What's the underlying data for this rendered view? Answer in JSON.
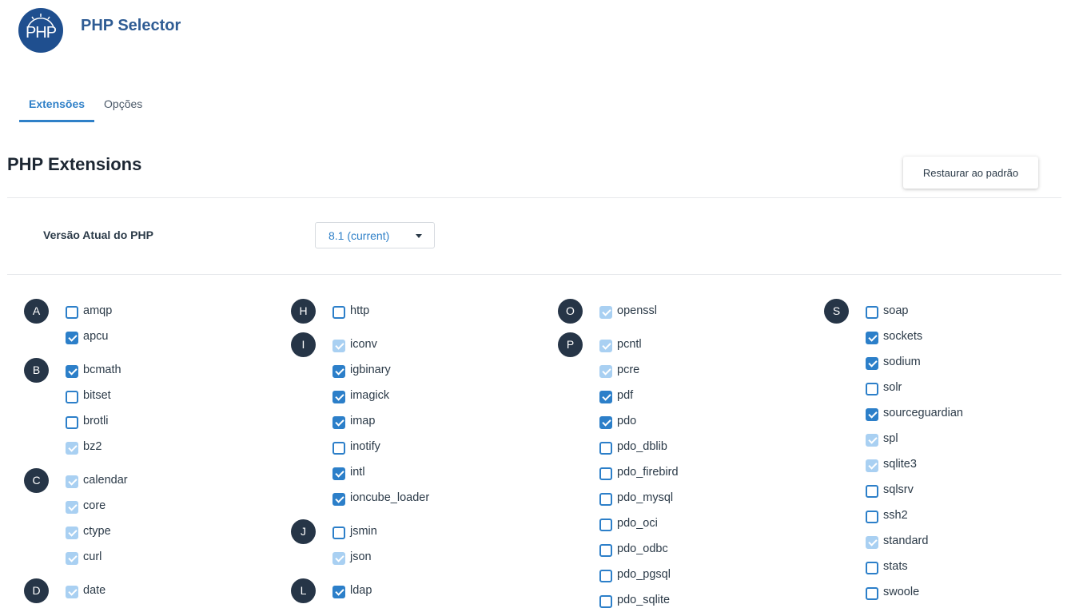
{
  "header": {
    "logo_text": "PHP",
    "title": "PHP Selector"
  },
  "tabs": [
    {
      "label": "Extensões",
      "active": true
    },
    {
      "label": "Opções",
      "active": false
    }
  ],
  "section": {
    "title": "PHP Extensions",
    "restore_label": "Restaurar ao padrão"
  },
  "version": {
    "label": "Versão Atual do PHP",
    "value": "8.1 (current)"
  },
  "colors": {
    "accent": "#2c7fc9",
    "disabled_check": "#a9d0f2",
    "letter_badge": "#263547",
    "title": "#2f5c94"
  },
  "columns": [
    [
      {
        "letter": "A",
        "items": [
          {
            "label": "amqp",
            "state": "unchecked"
          },
          {
            "label": "apcu",
            "state": "checked"
          }
        ]
      },
      {
        "letter": "B",
        "items": [
          {
            "label": "bcmath",
            "state": "checked"
          },
          {
            "label": "bitset",
            "state": "unchecked"
          },
          {
            "label": "brotli",
            "state": "unchecked"
          },
          {
            "label": "bz2",
            "state": "disabled"
          }
        ]
      },
      {
        "letter": "C",
        "items": [
          {
            "label": "calendar",
            "state": "disabled"
          },
          {
            "label": "core",
            "state": "disabled"
          },
          {
            "label": "ctype",
            "state": "disabled"
          },
          {
            "label": "curl",
            "state": "disabled"
          }
        ]
      },
      {
        "letter": "D",
        "items": [
          {
            "label": "date",
            "state": "disabled"
          }
        ]
      }
    ],
    [
      {
        "letter": "H",
        "items": [
          {
            "label": "http",
            "state": "unchecked"
          }
        ]
      },
      {
        "letter": "I",
        "items": [
          {
            "label": "iconv",
            "state": "disabled"
          },
          {
            "label": "igbinary",
            "state": "checked"
          },
          {
            "label": "imagick",
            "state": "checked"
          },
          {
            "label": "imap",
            "state": "checked"
          },
          {
            "label": "inotify",
            "state": "unchecked"
          },
          {
            "label": "intl",
            "state": "checked"
          },
          {
            "label": "ioncube_loader",
            "state": "checked"
          }
        ]
      },
      {
        "letter": "J",
        "items": [
          {
            "label": "jsmin",
            "state": "unchecked"
          },
          {
            "label": "json",
            "state": "disabled"
          }
        ]
      },
      {
        "letter": "L",
        "items": [
          {
            "label": "ldap",
            "state": "checked"
          }
        ]
      }
    ],
    [
      {
        "letter": "O",
        "items": [
          {
            "label": "openssl",
            "state": "disabled"
          }
        ]
      },
      {
        "letter": "P",
        "items": [
          {
            "label": "pcntl",
            "state": "disabled"
          },
          {
            "label": "pcre",
            "state": "disabled"
          },
          {
            "label": "pdf",
            "state": "checked"
          },
          {
            "label": "pdo",
            "state": "checked"
          },
          {
            "label": "pdo_dblib",
            "state": "unchecked"
          },
          {
            "label": "pdo_firebird",
            "state": "unchecked"
          },
          {
            "label": "pdo_mysql",
            "state": "unchecked"
          },
          {
            "label": "pdo_oci",
            "state": "unchecked"
          },
          {
            "label": "pdo_odbc",
            "state": "unchecked"
          },
          {
            "label": "pdo_pgsql",
            "state": "unchecked"
          },
          {
            "label": "pdo_sqlite",
            "state": "unchecked"
          }
        ]
      }
    ],
    [
      {
        "letter": "S",
        "items": [
          {
            "label": "soap",
            "state": "unchecked"
          },
          {
            "label": "sockets",
            "state": "checked"
          },
          {
            "label": "sodium",
            "state": "checked"
          },
          {
            "label": "solr",
            "state": "unchecked"
          },
          {
            "label": "sourceguardian",
            "state": "checked"
          },
          {
            "label": "spl",
            "state": "disabled"
          },
          {
            "label": "sqlite3",
            "state": "disabled"
          },
          {
            "label": "sqlsrv",
            "state": "unchecked"
          },
          {
            "label": "ssh2",
            "state": "unchecked"
          },
          {
            "label": "standard",
            "state": "disabled"
          },
          {
            "label": "stats",
            "state": "unchecked"
          },
          {
            "label": "swoole",
            "state": "unchecked"
          }
        ]
      }
    ]
  ]
}
